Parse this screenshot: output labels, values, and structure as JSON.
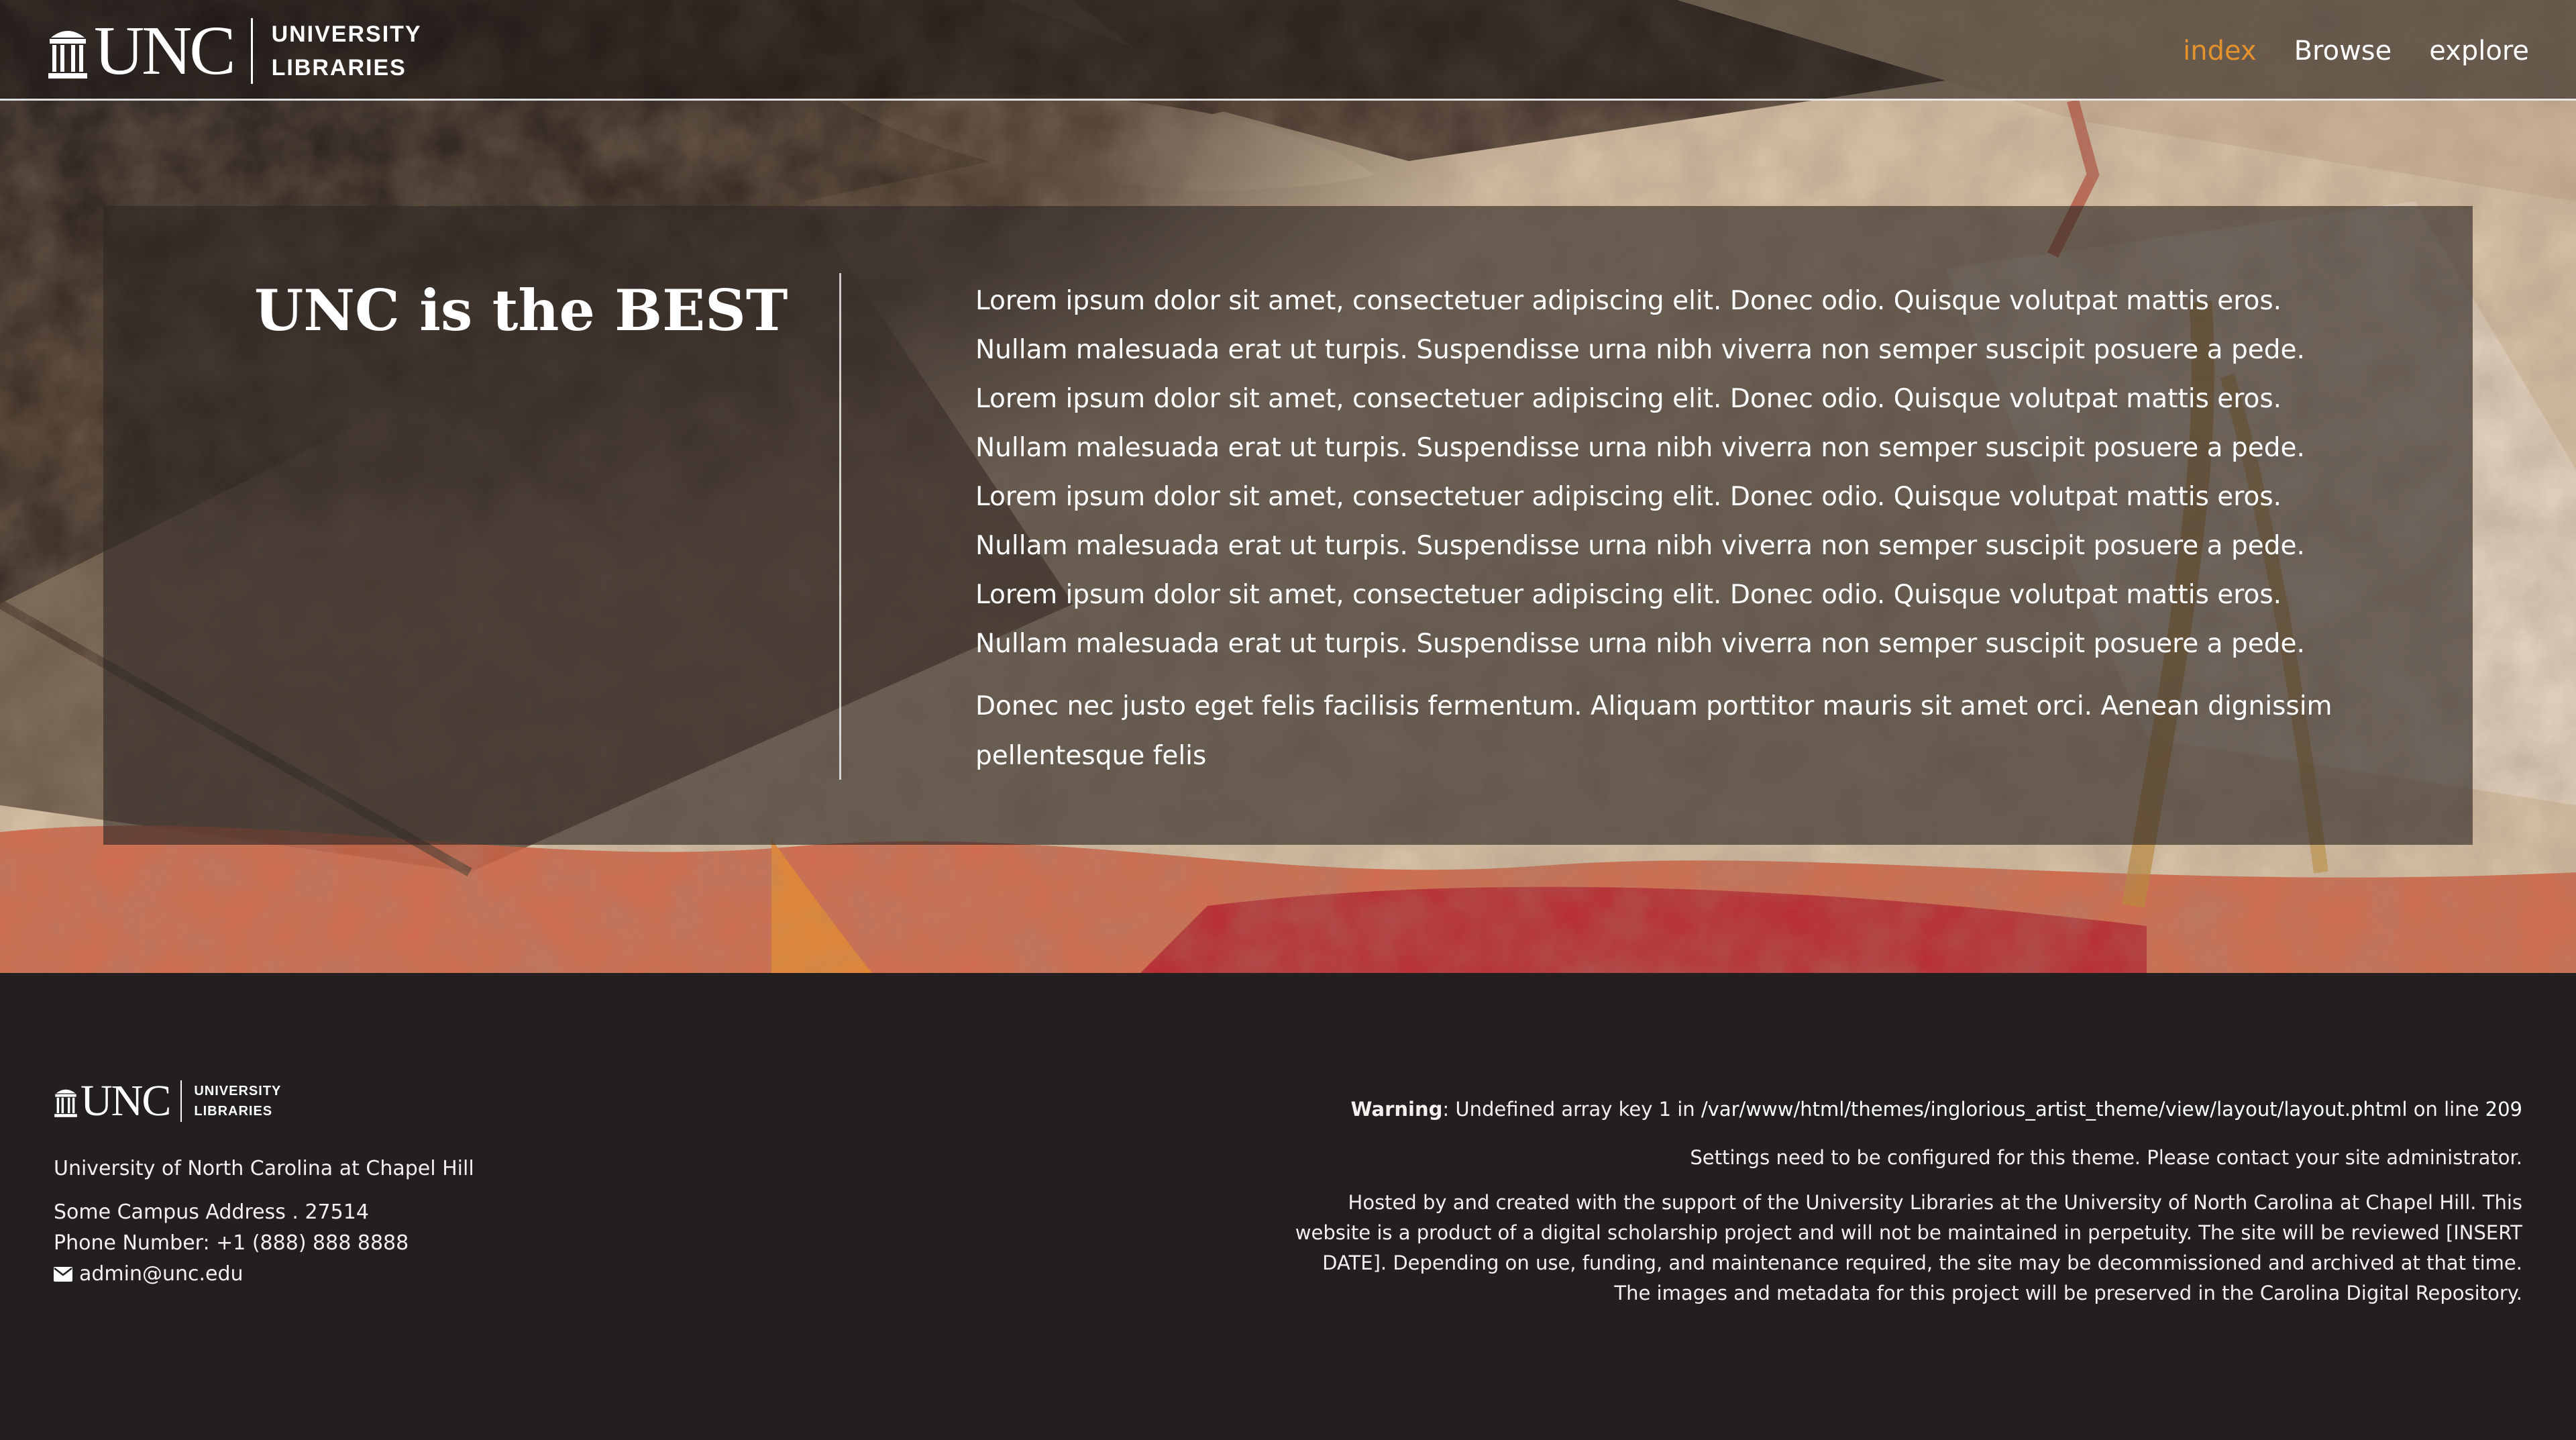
{
  "header": {
    "logo": {
      "wordmark": "UNC",
      "line1": "UNIVERSITY",
      "line2": "LIBRARIES"
    },
    "nav": [
      {
        "label": "index",
        "active": true
      },
      {
        "label": "Browse",
        "active": false
      },
      {
        "label": "explore",
        "active": false
      }
    ]
  },
  "intro": {
    "title": "UNC is the BEST",
    "lead_lines": [
      "Lorem ipsum dolor sit amet, consectetuer adipiscing elit. Donec odio. Quisque volutpat mattis eros.",
      "Nullam malesuada erat ut turpis. Suspendisse urna nibh viverra non semper suscipit posuere a pede.",
      "Lorem ipsum dolor sit amet, consectetuer adipiscing elit. Donec odio. Quisque volutpat mattis eros.",
      "Nullam malesuada erat ut turpis. Suspendisse urna nibh viverra non semper suscipit posuere a pede.",
      "Lorem ipsum dolor sit amet, consectetuer adipiscing elit. Donec odio. Quisque volutpat mattis eros.",
      "Nullam malesuada erat ut turpis. Suspendisse urna nibh viverra non semper suscipit posuere a pede.",
      "Lorem ipsum dolor sit amet, consectetuer adipiscing elit. Donec odio. Quisque volutpat mattis eros.",
      "Nullam malesuada erat ut turpis. Suspendisse urna nibh viverra non semper suscipit posuere a pede."
    ],
    "extra": "Donec nec justo eget felis facilisis fermentum. Aliquam porttitor mauris sit amet orci. Aenean dignissim pellentesque felis"
  },
  "footer": {
    "logo": {
      "wordmark": "UNC",
      "line1": "UNIVERSITY",
      "line2": "LIBRARIES"
    },
    "institution": "University of North Carolina at Chapel Hill",
    "address": "Some Campus Address . 27514",
    "phone": "Phone Number: +1 (888) 888 8888",
    "email": "admin@unc.edu",
    "email_icon": "envelope-icon",
    "warning": {
      "label": "Warning",
      "text_before": ": Undefined array key 1 in ",
      "path": "/var/www/html/themes/inglorious_artist_theme/view/layout/layout.phtml",
      "text_mid": " on line ",
      "line": "209"
    },
    "settings_notice": "Settings need to be configured for this theme. Please contact your site administrator.",
    "hosted_lines": [
      "Hosted by and created with the support of the University Libraries at the University of North Carolina at Chapel Hill. This",
      "website is a product of a digital scholarship project and will not be maintained in perpetuity. The site will be reviewed [INSERT",
      "DATE]. Depending on use, funding, and maintenance required, the site may be decommissioned and archived at that time.",
      "The images and metadata for this project will be preserved in the Carolina Digital Repository."
    ]
  },
  "colors": {
    "accent": "#e4932c",
    "footer_bg": "#231f21",
    "panel_bg": "rgba(48,40,38,0.64)"
  }
}
